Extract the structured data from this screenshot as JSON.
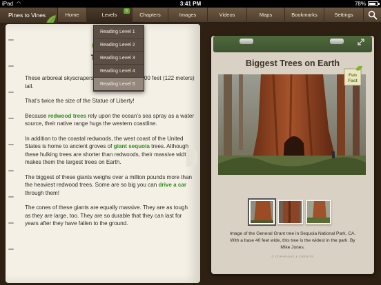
{
  "status_bar": {
    "carrier": "iPad",
    "time": "3:41 PM",
    "battery": "78%"
  },
  "nav": {
    "brand": "Pines to Vines",
    "items": [
      {
        "label": "Home"
      },
      {
        "label": "Levels",
        "badge": "5"
      },
      {
        "label": "Chapters"
      },
      {
        "label": "Images"
      },
      {
        "label": "Videos"
      },
      {
        "label": "Maps"
      },
      {
        "label": "Bookmarks"
      },
      {
        "label": "Settings"
      }
    ]
  },
  "levels_menu": {
    "options": [
      "Reading Level 1",
      "Reading Level 2",
      "Reading Level 3",
      "Reading Level 4",
      "Reading Level 5"
    ],
    "selected": "Reading Level 5"
  },
  "left_page": {
    "title": "Cha",
    "subtitle": "Tempe",
    "p1_a": "These arboreal skyscrapers",
    "p1_b": "400 feet (122 meters) tall.",
    "p2": "That’s twice the size of the Statue of Liberty!",
    "p3_a": "Because ",
    "p3_hl": "redwood trees",
    "p3_b": " rely upon the ocean’s sea spray as a water source, their native range hugs the western coastline.",
    "p4_a": "In addition to the coastal redwoods, the west coast of the United States is home to ancient groves of ",
    "p4_hl": "giant sequoia",
    "p4_b": " trees. Although these hulking trees are shorter than redwoods, their massive width makes them the largest trees on Earth.",
    "p5_a": "The biggest of these giants weighs over a million pounds more than the heaviest redwood trees. Some are so big you can ",
    "p5_hl": "drive a car",
    "p5_b": " through them!",
    "p6": "The cones of these giants are equally massive. They are as tough as they are large, too. They are so durable that they can last for years after they have fallen to the ground."
  },
  "right_page": {
    "title": "Biggest Trees on Earth",
    "badge_line1": "Fun",
    "badge_line2": "Fact",
    "caption": "Image of the General Grant tree in Sequoia National Park, CA.  With a base 40 feet wide, this tree is the widest in the park.  By Mike Jones.",
    "copyright": "© COPYRIGHT & CREDITS"
  },
  "colors": {
    "accent_green": "#6fa234",
    "nav_brown": "#5a4733",
    "page_cream": "#f4f0e5"
  }
}
